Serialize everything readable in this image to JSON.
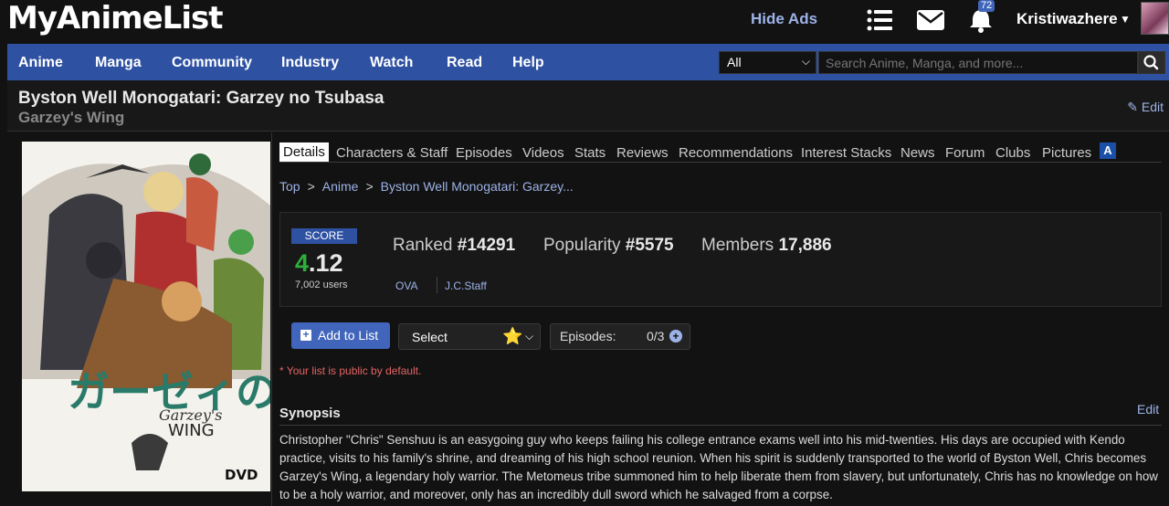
{
  "header": {
    "logo": "MyAnimeList",
    "hide_ads": "Hide Ads",
    "notification_count": "72",
    "username": "Kristiwazhere"
  },
  "nav": {
    "items": [
      "Anime",
      "Manga",
      "Community",
      "Industry",
      "Watch",
      "Read",
      "Help"
    ],
    "search_category": "All",
    "search_placeholder": "Search Anime, Manga, and more..."
  },
  "title": {
    "main": "Byston Well Monogatari: Garzey no Tsubasa",
    "sub": "Garzey's Wing",
    "edit": "Edit"
  },
  "cover": {
    "title_text": "WING",
    "title_prefix": "Garzey's",
    "badge": "DVD"
  },
  "tabs": [
    "Details",
    "Characters & Staff",
    "Episodes",
    "Videos",
    "Stats",
    "Reviews",
    "Recommendations",
    "Interest Stacks",
    "News",
    "Forum",
    "Clubs",
    "Pictures"
  ],
  "tab_logo": "A",
  "breadcrumb": [
    "Top",
    "Anime",
    "Byston Well Monogatari: Garzey..."
  ],
  "stats": {
    "score_label": "SCORE",
    "score_lead": "4",
    "score_rest": ".12",
    "score_users": "7,002 users",
    "ranked_label": "Ranked",
    "ranked_value": "#14291",
    "popularity_label": "Popularity",
    "popularity_value": "#5575",
    "members_label": "Members",
    "members_value": "17,886",
    "type": "OVA",
    "studio": "J.C.Staff"
  },
  "list": {
    "add_button": "Add to List",
    "status_select": "Select",
    "episodes_label": "Episodes:",
    "episodes_count": "0/3",
    "public_note": "* Your list is public by default."
  },
  "synopsis": {
    "title": "Synopsis",
    "edit": "Edit",
    "text": "Christopher \"Chris\" Senshuu is an easygoing guy who keeps failing his college entrance exams well into his mid-twenties. His days are occupied with Kendo practice, visits to his family's shrine, and dreaming of his high school reunion. When his spirit is suddenly transported to the world of Byston Well, Chris becomes Garzey's Wing, a legendary holy warrior. The Metomeus tribe summoned him to help liberate them from slavery, but unfortunately, Chris has no knowledge on how to be a holy warrior, and moreover, only has an incredibly dull sword which he salvaged from a corpse."
  },
  "colors": {
    "nav_bg": "#2e51a2",
    "link": "#9db3e8",
    "score_green": "#2db039",
    "note_red": "#e36464",
    "button_blue": "#4065ba"
  }
}
